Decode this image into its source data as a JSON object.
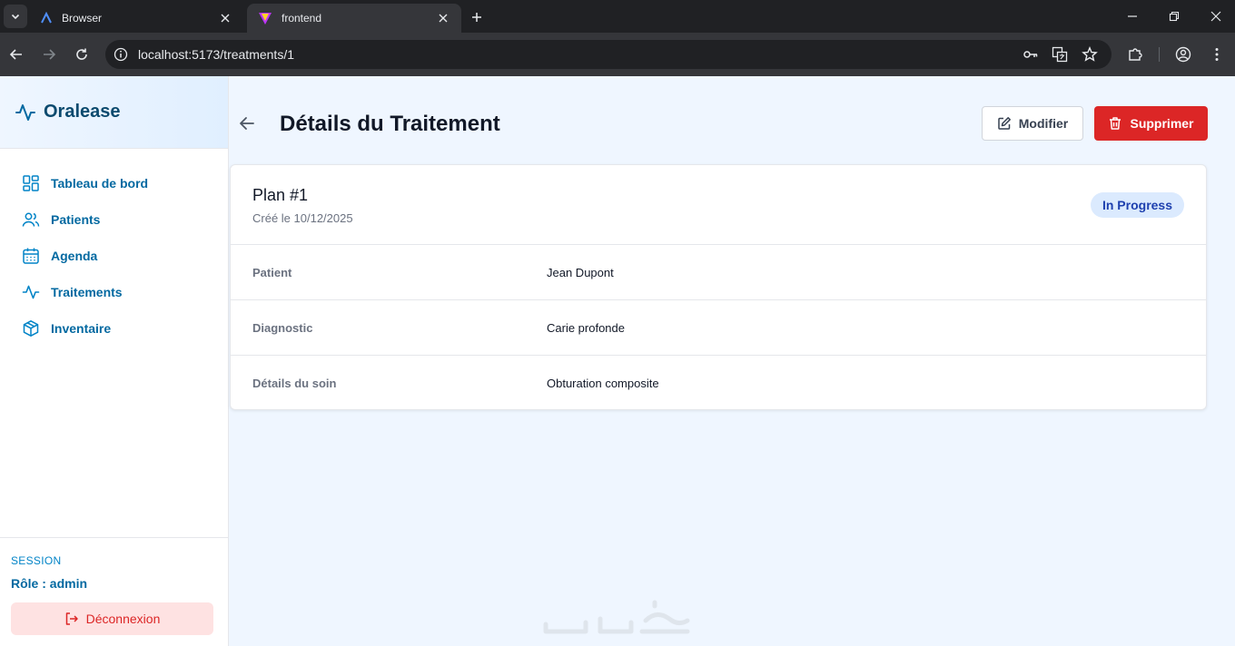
{
  "browser": {
    "tabs": [
      {
        "title": "Browser",
        "active": false
      },
      {
        "title": "frontend",
        "active": true
      }
    ],
    "url": "localhost:5173/treatments/1"
  },
  "sidebar": {
    "brand": "Oralease",
    "items": [
      {
        "label": "Tableau de bord",
        "icon": "dashboard-icon"
      },
      {
        "label": "Patients",
        "icon": "users-icon"
      },
      {
        "label": "Agenda",
        "icon": "calendar-icon"
      },
      {
        "label": "Traitements",
        "icon": "activity-icon"
      },
      {
        "label": "Inventaire",
        "icon": "box-icon"
      }
    ],
    "session": {
      "heading": "SESSION",
      "role": "Rôle : admin",
      "logout_label": "Déconnexion"
    }
  },
  "main": {
    "title": "Détails du Traitement",
    "modify_label": "Modifier",
    "delete_label": "Supprimer",
    "plan": {
      "title": "Plan #1",
      "created": "Créé le 10/12/2025",
      "status": "In Progress"
    },
    "details": [
      {
        "label": "Patient",
        "value": "Jean Dupont"
      },
      {
        "label": "Diagnostic",
        "value": "Carie profonde"
      },
      {
        "label": "Détails du soin",
        "value": "Obturation composite"
      }
    ]
  },
  "colors": {
    "accent": "#0369a1",
    "danger": "#dc2626",
    "badge_bg": "#dbeafe",
    "page_bg": "#eff6ff"
  }
}
